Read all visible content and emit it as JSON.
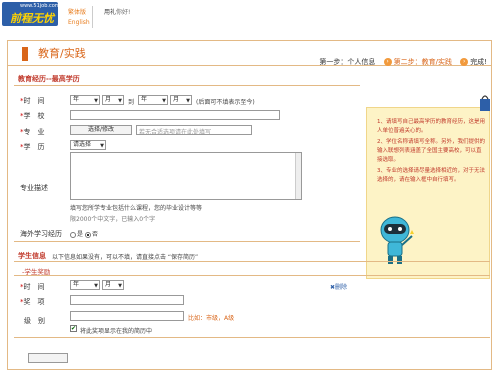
{
  "header": {
    "logo_url": "www.51job.com",
    "logo_text": "前程无忧",
    "version_cn": "繁体版",
    "version_en": "English",
    "greeting_name": "用礼",
    "greeting_text": "你好!"
  },
  "page": {
    "title": "教育/实践",
    "steps": [
      {
        "label": "第一步：个人信息"
      },
      {
        "label": "第二步：教育/实践"
      },
      {
        "label": "完成!"
      }
    ]
  },
  "education": {
    "section_title": "教育经历--最高学历",
    "time_label": "时　间",
    "year_placeholder": "年",
    "month_placeholder": "月",
    "to_text": "到",
    "time_hint": "(后面可不填表示至今)",
    "school_label": "学　校",
    "major_label": "专　业",
    "major_button": "选择/修改",
    "major_hint": "若无合适选项请在此处填写",
    "degree_label": "学　历",
    "degree_value": "请选择",
    "desc_label": "专业描述",
    "desc_hint": "填写您所学专业包括什么课程，您的毕业设计等等",
    "desc_counter": "限2000个中文字，已输入0个字",
    "overseas_label": "海外学习经历",
    "yes": "是",
    "no": "否"
  },
  "notes": [
    "请填写自己最高学历的教育经历，这是用人单位普遍关心的。",
    "学位名称请填写全称。另外，我们提供的输入联想列表涵盖了全国主要高校，可以直接选取。",
    "专业的选择请尽量选择相近的，对于无法选择的，请在输入框中自行填写。"
  ],
  "student": {
    "section_title": "学生信息",
    "section_hint": "以下信息如果没有，可以不填，请直接点击 “保存简历”",
    "subsection": "-学生奖励",
    "time_label": "时　间",
    "year_placeholder": "年",
    "month_placeholder": "月",
    "delete_label": "删除",
    "award_label": "奖　项",
    "level_label": "级　别",
    "level_hint": "比如：市级，A级",
    "show_label": "将此奖项显示在我的简历中"
  },
  "colors": {
    "accent": "#d9661a",
    "frame_border": "#e3b985",
    "note_bg": "#fdf3c6"
  }
}
